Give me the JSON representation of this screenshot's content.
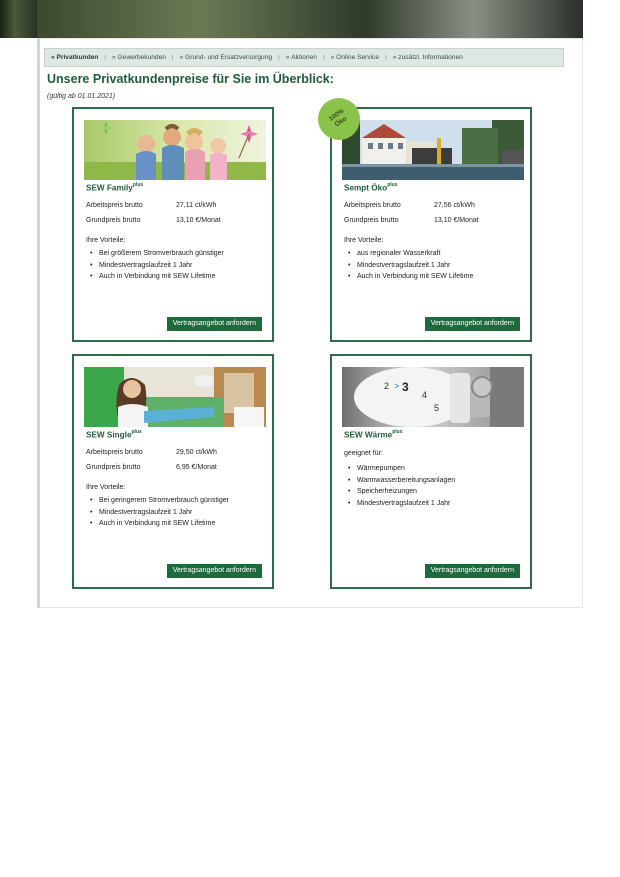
{
  "nav": {
    "items": [
      {
        "label": "Privatkunden",
        "active": true
      },
      {
        "label": "Gewerbekunden",
        "active": false
      },
      {
        "label": "Grund- und Ersatzversorgung",
        "active": false
      },
      {
        "label": "Aktionen",
        "active": false
      },
      {
        "label": "Online Service",
        "active": false
      },
      {
        "label": "zusätzl. Informationen",
        "active": false
      }
    ],
    "arrow": "»",
    "separator": "|"
  },
  "page_title": "Unsere Privatkundenpreise für Sie im Überblick:",
  "validity": "(gültig ab 01.01.2021)",
  "eco_badge": {
    "line1": "100%",
    "line2": "Öko"
  },
  "cards": [
    {
      "name": "SEW Family",
      "sup": "plus",
      "rows": [
        {
          "label": "Arbeitspreis brutto",
          "value": "27,11 ct/kWh"
        },
        {
          "label": "Grundpreis brutto",
          "value": "13,10 €/Monat"
        }
      ],
      "intro": "Ihre Vorteile:",
      "bullets": [
        "Bei größerem Stromverbrauch günstiger",
        "Mindestvertragslaufzeit 1 Jahr",
        "Auch in Verbindung mit SEW Lifetime"
      ],
      "cta": "Vertragsangebot anfordern"
    },
    {
      "name": "Sempt Öko",
      "sup": "plus",
      "rows": [
        {
          "label": "Arbeitspreis brutto",
          "value": "27,56 ct/kWh"
        },
        {
          "label": "Grundpreis brutto",
          "value": "13,10 €/Monat"
        }
      ],
      "intro": "Ihre Vorteile:",
      "bullets": [
        "aus regionaler Wasserkraft",
        "Mindestvertragslaufzeit 1 Jahr",
        "Auch in Verbindung mit SEW Lifetime"
      ],
      "cta": "Vertragsangebot anfordern"
    },
    {
      "name": "SEW Single",
      "sup": "plus",
      "rows": [
        {
          "label": "Arbeitspreis brutto",
          "value": "29,50 ct/kWh"
        },
        {
          "label": "Grundpreis brutto",
          "value": "6,95 €/Monat"
        }
      ],
      "intro": "Ihre Vorteile:",
      "bullets": [
        "Bei geringerem Stromverbrauch günstiger",
        "Mindestvertragslaufzeit 1 Jahr",
        "Auch in Verbindung mit SEW Lifetime"
      ],
      "cta": "Vertragsangebot anfordern"
    },
    {
      "name": "SEW Wärme",
      "sup": "plus",
      "rows": [],
      "intro": "geeignet für:",
      "bullets": [
        "Wärmepumpen",
        "Warmwasserbereitungsanlagen",
        "Speicherheizungen",
        "Mindestvertragslaufzeit 1 Jahr"
      ],
      "cta": "Vertragsangebot anfordern"
    }
  ],
  "thermostat_digits": [
    "2",
    ">",
    "3",
    "4",
    "5"
  ],
  "colors": {
    "brand_green": "#205c3b",
    "button_green": "#1f6a3c",
    "badge_green": "#8bc34a",
    "nav_bg": "#dfe7e2"
  }
}
